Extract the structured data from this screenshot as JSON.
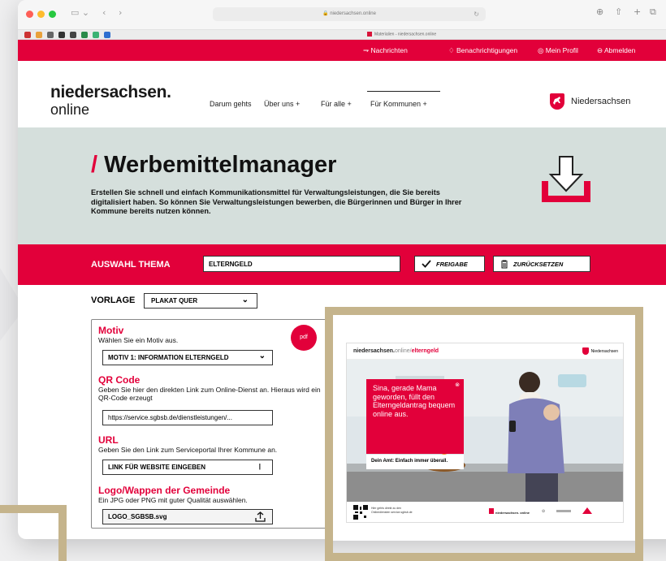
{
  "browser": {
    "address": "niedersachsen.online",
    "tab_title": "Materialien - niedersachsen.online"
  },
  "topbar": {
    "links": [
      "Nachrichten",
      "Benachrichtigungen",
      "Mein Profil",
      "Abmelden"
    ]
  },
  "header": {
    "logo_line1": "niedersachsen.",
    "logo_line2": "online",
    "nav": [
      "Darum gehts",
      "Über uns +",
      "Für alle +",
      "Für Kommunen +"
    ],
    "state": "Niedersachsen"
  },
  "hero": {
    "slash": "/",
    "title": "Werbemittelmanager",
    "text": "Erstellen Sie schnell und einfach Kommunikationsmittel für Verwaltungsleistungen, die Sie bereits digitalisiert haben. So können Sie Verwaltungsleistungen bewerben, die Bürgerinnen und Bürger in Ihrer Kommune bereits nutzen können."
  },
  "theme": {
    "label": "AUSWAHL THEMA",
    "value": "ELTERNGELD",
    "release": "FREIGABE",
    "reset": "ZURÜCKSETZEN"
  },
  "template": {
    "label": "VORLAGE",
    "value": "PLAKAT QUER"
  },
  "form": {
    "pdf": "pdf",
    "motiv_title": "Motiv",
    "motiv_desc": "Wählen Sie ein Motiv aus.",
    "motiv_value": "MOTIV 1: INFORMATION ELTERNGELD",
    "qr_title": "QR Code",
    "qr_desc": "Geben Sie hier den direkten Link zum Online-Dienst an. Hieraus wird ein QR-Code erzeugt",
    "qr_value": "https://service.sgbsb.de/dienstleistungen/...",
    "url_title": "URL",
    "url_desc": "Geben Sie den Link zum Serviceportal Ihrer Kommune an.",
    "url_value": "LINK FÜR WEBSITE EINGEBEN",
    "logo_title": "Logo/Wappen der Gemeinde",
    "logo_desc": "Ein JPG oder PNG mit guter Qualität auswählen.",
    "logo_value": "LOGO_SGBSB.svg"
  },
  "poster": {
    "brand": "niedersachsen.",
    "brand_online": "online/",
    "brand_topic": "elterngeld",
    "state": "Niedersachsen",
    "headline": "Sina, gerade Mama geworden, füllt den Elterngeldantrag bequem online aus.",
    "slogan": "Dein Amt: Einfach immer überall.",
    "qr_caption": "Hier gehts direkt zu den Onlinediensten service.sgbsb.de",
    "footer_brand": "niedersachsen. online"
  },
  "colors": {
    "brand_red": "#e2003a",
    "hero_bg": "#d5dfdc",
    "gold_frame": "#c5b48c"
  }
}
